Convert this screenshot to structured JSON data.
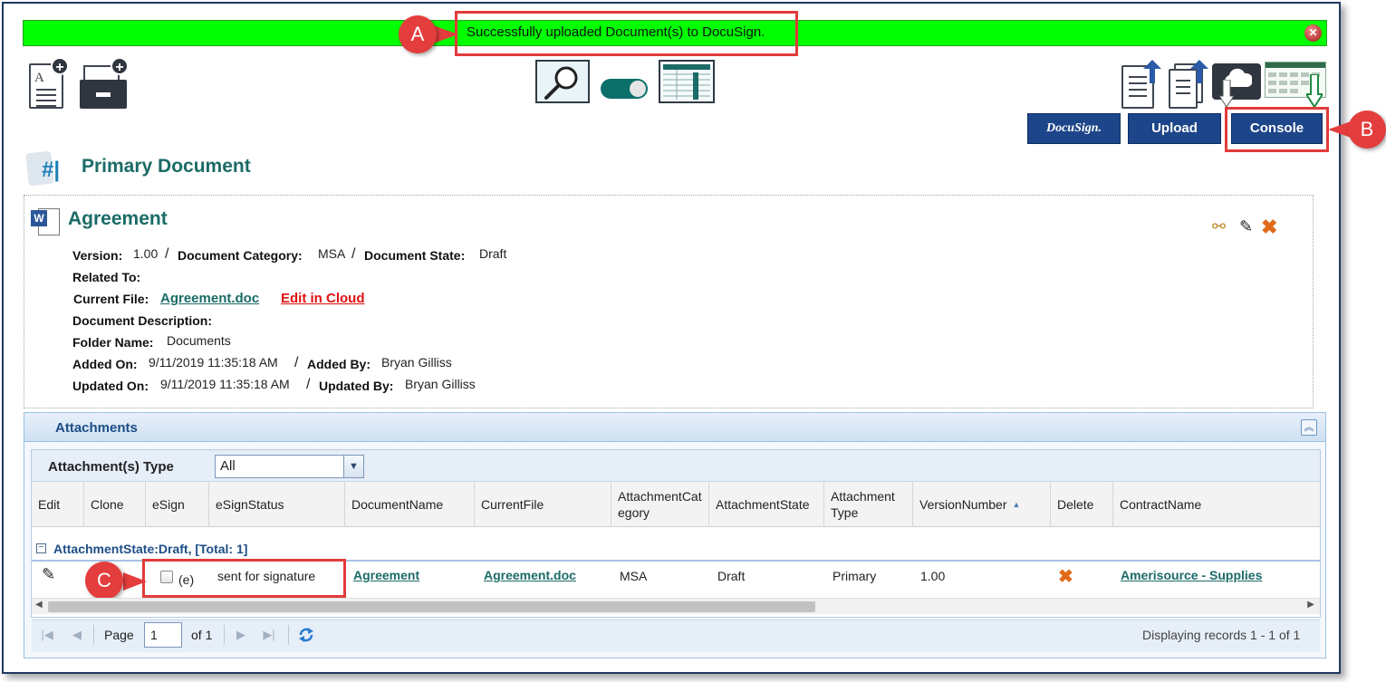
{
  "banner": {
    "message": "Successfully uploaded Document(s) to DocuSign.",
    "close_icon": "close-icon",
    "color": "#00ff00"
  },
  "callouts": {
    "a": "A",
    "b": "B",
    "c": "C"
  },
  "toolbar": {
    "docusign_label": "DocuSign.",
    "upload_label": "Upload",
    "console_label": "Console"
  },
  "section": {
    "title": "Primary Document"
  },
  "document": {
    "title": "Agreement",
    "version_label": "Version:",
    "version": "1.00",
    "category_label": "Document Category:",
    "category": "MSA",
    "state_label": "Document State:",
    "state": "Draft",
    "related_label": "Related To:",
    "current_file_label": "Current File:",
    "current_file": "Agreement.doc",
    "edit_cloud": "Edit in Cloud",
    "description_label": "Document Description:",
    "folder_label": "Folder Name:",
    "folder": "Documents",
    "added_on_label": "Added On:",
    "added_on": "9/11/2019 11:35:18 AM",
    "added_by_label": "Added By:",
    "added_by": "Bryan Gilliss",
    "updated_on_label": "Updated On:",
    "updated_on": "9/11/2019 11:35:18 AM",
    "updated_by_label": "Updated By:",
    "updated_by": "Bryan Gilliss",
    "separator": "/"
  },
  "attachments": {
    "title": "Attachments",
    "filter_label": "Attachment(s) Type",
    "filter_value": "All",
    "columns": {
      "edit": "Edit",
      "clone": "Clone",
      "esign": "eSign",
      "esign_status": "eSignStatus",
      "document_name": "DocumentName",
      "current_file": "CurrentFile",
      "att_category": "AttachmentCategory",
      "att_state": "AttachmentState",
      "att_type": "Attachment Type",
      "version": "VersionNumber",
      "delete": "Delete",
      "contract": "ContractName"
    },
    "group_label": "AttachmentState:Draft, [Total: 1]",
    "row": {
      "esign_suffix": "(e)",
      "esign_status": "sent for signature",
      "document_name": "Agreement",
      "current_file": "Agreement.doc",
      "category": "MSA",
      "state": "Draft",
      "type": "Primary",
      "version": "1.00",
      "contract": "Amerisource - Supplies"
    },
    "pager": {
      "page_label": "Page",
      "page_value": "1",
      "of_label": "of 1",
      "display": "Displaying records 1 - 1 of 1"
    }
  }
}
